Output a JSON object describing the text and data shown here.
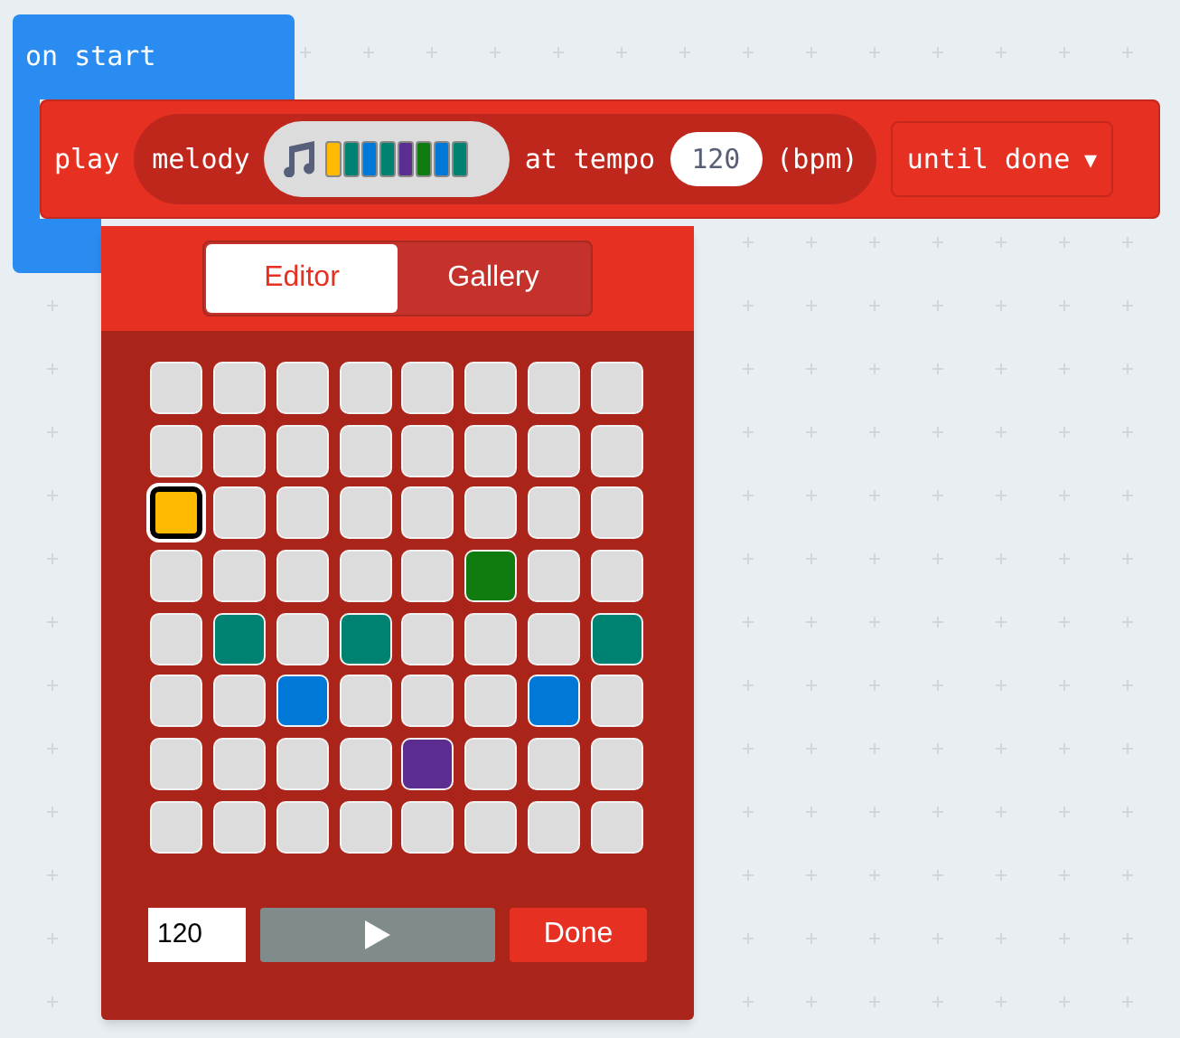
{
  "event_block": {
    "label": "on start"
  },
  "play_block": {
    "label": "play",
    "melody_label": "melody",
    "melody_preview": [
      {
        "color": "#ffb900"
      },
      {
        "color": "#008272"
      },
      {
        "color": "#0078d7"
      },
      {
        "color": "#008272"
      },
      {
        "color": "#5c2d91"
      },
      {
        "color": "#107c10"
      },
      {
        "color": "#0078d7"
      },
      {
        "color": "#008272"
      }
    ],
    "tempo_label": "at tempo",
    "tempo": "120",
    "unit_label": "(bpm)",
    "mode": "until done",
    "dropdown_arrow": "▾"
  },
  "editor": {
    "tabs": [
      {
        "label": "Editor",
        "selected": true
      },
      {
        "label": "Gallery",
        "selected": false
      }
    ],
    "grid": [
      {
        "cells": [
          {
            "selected": false
          },
          {
            "selected": false
          },
          {
            "selected": false
          },
          {
            "selected": false
          },
          {
            "selected": false
          },
          {
            "selected": false
          },
          {
            "selected": false
          },
          {
            "selected": false
          }
        ]
      },
      {
        "cells": [
          {
            "selected": false
          },
          {
            "selected": false
          },
          {
            "selected": false
          },
          {
            "selected": false
          },
          {
            "selected": false
          },
          {
            "selected": false
          },
          {
            "selected": false
          },
          {
            "selected": false
          }
        ]
      },
      {
        "cells": [
          {
            "selected": true,
            "color": "#ffb900"
          },
          {
            "selected": false
          },
          {
            "selected": false
          },
          {
            "selected": false
          },
          {
            "selected": false
          },
          {
            "selected": false
          },
          {
            "selected": false
          },
          {
            "selected": false
          }
        ]
      },
      {
        "cells": [
          {
            "selected": false
          },
          {
            "selected": false
          },
          {
            "selected": false
          },
          {
            "selected": false
          },
          {
            "selected": false
          },
          {
            "selected": false,
            "color": "#107c10"
          },
          {
            "selected": false
          },
          {
            "selected": false
          }
        ]
      },
      {
        "cells": [
          {
            "selected": false
          },
          {
            "selected": false,
            "color": "#008272"
          },
          {
            "selected": false
          },
          {
            "selected": false,
            "color": "#008272"
          },
          {
            "selected": false
          },
          {
            "selected": false
          },
          {
            "selected": false
          },
          {
            "selected": false,
            "color": "#008272"
          }
        ]
      },
      {
        "cells": [
          {
            "selected": false
          },
          {
            "selected": false
          },
          {
            "selected": false,
            "color": "#0078d7"
          },
          {
            "selected": false
          },
          {
            "selected": false
          },
          {
            "selected": false
          },
          {
            "selected": false,
            "color": "#0078d7"
          },
          {
            "selected": false
          }
        ]
      },
      {
        "cells": [
          {
            "selected": false
          },
          {
            "selected": false
          },
          {
            "selected": false
          },
          {
            "selected": false
          },
          {
            "selected": false,
            "color": "#5c2d91"
          },
          {
            "selected": false
          },
          {
            "selected": false
          },
          {
            "selected": false
          }
        ]
      },
      {
        "cells": [
          {
            "selected": false
          },
          {
            "selected": false
          },
          {
            "selected": false
          },
          {
            "selected": false
          },
          {
            "selected": false
          },
          {
            "selected": false
          },
          {
            "selected": false
          },
          {
            "selected": false
          }
        ]
      }
    ],
    "tempo_value": "120",
    "done_button": "Done"
  }
}
